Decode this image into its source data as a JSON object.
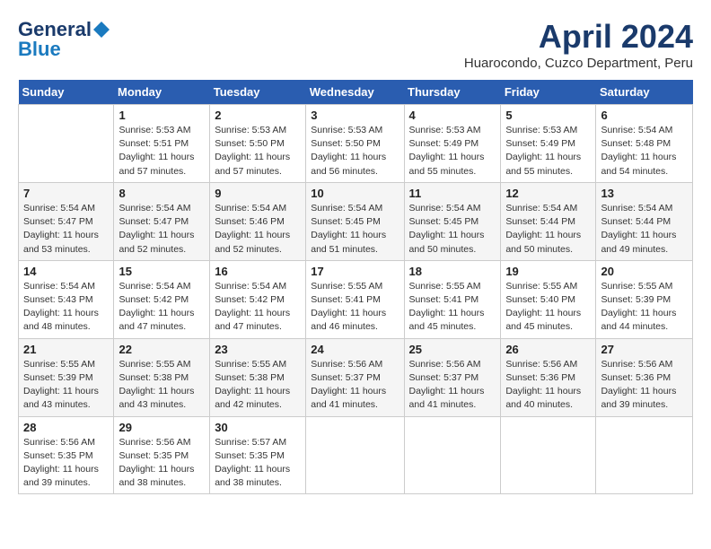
{
  "header": {
    "logo_general": "General",
    "logo_blue": "Blue",
    "title": "April 2024",
    "location": "Huarocondo, Cuzco Department, Peru"
  },
  "columns": [
    "Sunday",
    "Monday",
    "Tuesday",
    "Wednesday",
    "Thursday",
    "Friday",
    "Saturday"
  ],
  "weeks": [
    [
      {
        "day": "",
        "info": ""
      },
      {
        "day": "1",
        "info": "Sunrise: 5:53 AM\nSunset: 5:51 PM\nDaylight: 11 hours\nand 57 minutes."
      },
      {
        "day": "2",
        "info": "Sunrise: 5:53 AM\nSunset: 5:50 PM\nDaylight: 11 hours\nand 57 minutes."
      },
      {
        "day": "3",
        "info": "Sunrise: 5:53 AM\nSunset: 5:50 PM\nDaylight: 11 hours\nand 56 minutes."
      },
      {
        "day": "4",
        "info": "Sunrise: 5:53 AM\nSunset: 5:49 PM\nDaylight: 11 hours\nand 55 minutes."
      },
      {
        "day": "5",
        "info": "Sunrise: 5:53 AM\nSunset: 5:49 PM\nDaylight: 11 hours\nand 55 minutes."
      },
      {
        "day": "6",
        "info": "Sunrise: 5:54 AM\nSunset: 5:48 PM\nDaylight: 11 hours\nand 54 minutes."
      }
    ],
    [
      {
        "day": "7",
        "info": "Sunrise: 5:54 AM\nSunset: 5:47 PM\nDaylight: 11 hours\nand 53 minutes."
      },
      {
        "day": "8",
        "info": "Sunrise: 5:54 AM\nSunset: 5:47 PM\nDaylight: 11 hours\nand 52 minutes."
      },
      {
        "day": "9",
        "info": "Sunrise: 5:54 AM\nSunset: 5:46 PM\nDaylight: 11 hours\nand 52 minutes."
      },
      {
        "day": "10",
        "info": "Sunrise: 5:54 AM\nSunset: 5:45 PM\nDaylight: 11 hours\nand 51 minutes."
      },
      {
        "day": "11",
        "info": "Sunrise: 5:54 AM\nSunset: 5:45 PM\nDaylight: 11 hours\nand 50 minutes."
      },
      {
        "day": "12",
        "info": "Sunrise: 5:54 AM\nSunset: 5:44 PM\nDaylight: 11 hours\nand 50 minutes."
      },
      {
        "day": "13",
        "info": "Sunrise: 5:54 AM\nSunset: 5:44 PM\nDaylight: 11 hours\nand 49 minutes."
      }
    ],
    [
      {
        "day": "14",
        "info": "Sunrise: 5:54 AM\nSunset: 5:43 PM\nDaylight: 11 hours\nand 48 minutes."
      },
      {
        "day": "15",
        "info": "Sunrise: 5:54 AM\nSunset: 5:42 PM\nDaylight: 11 hours\nand 47 minutes."
      },
      {
        "day": "16",
        "info": "Sunrise: 5:54 AM\nSunset: 5:42 PM\nDaylight: 11 hours\nand 47 minutes."
      },
      {
        "day": "17",
        "info": "Sunrise: 5:55 AM\nSunset: 5:41 PM\nDaylight: 11 hours\nand 46 minutes."
      },
      {
        "day": "18",
        "info": "Sunrise: 5:55 AM\nSunset: 5:41 PM\nDaylight: 11 hours\nand 45 minutes."
      },
      {
        "day": "19",
        "info": "Sunrise: 5:55 AM\nSunset: 5:40 PM\nDaylight: 11 hours\nand 45 minutes."
      },
      {
        "day": "20",
        "info": "Sunrise: 5:55 AM\nSunset: 5:39 PM\nDaylight: 11 hours\nand 44 minutes."
      }
    ],
    [
      {
        "day": "21",
        "info": "Sunrise: 5:55 AM\nSunset: 5:39 PM\nDaylight: 11 hours\nand 43 minutes."
      },
      {
        "day": "22",
        "info": "Sunrise: 5:55 AM\nSunset: 5:38 PM\nDaylight: 11 hours\nand 43 minutes."
      },
      {
        "day": "23",
        "info": "Sunrise: 5:55 AM\nSunset: 5:38 PM\nDaylight: 11 hours\nand 42 minutes."
      },
      {
        "day": "24",
        "info": "Sunrise: 5:56 AM\nSunset: 5:37 PM\nDaylight: 11 hours\nand 41 minutes."
      },
      {
        "day": "25",
        "info": "Sunrise: 5:56 AM\nSunset: 5:37 PM\nDaylight: 11 hours\nand 41 minutes."
      },
      {
        "day": "26",
        "info": "Sunrise: 5:56 AM\nSunset: 5:36 PM\nDaylight: 11 hours\nand 40 minutes."
      },
      {
        "day": "27",
        "info": "Sunrise: 5:56 AM\nSunset: 5:36 PM\nDaylight: 11 hours\nand 39 minutes."
      }
    ],
    [
      {
        "day": "28",
        "info": "Sunrise: 5:56 AM\nSunset: 5:35 PM\nDaylight: 11 hours\nand 39 minutes."
      },
      {
        "day": "29",
        "info": "Sunrise: 5:56 AM\nSunset: 5:35 PM\nDaylight: 11 hours\nand 38 minutes."
      },
      {
        "day": "30",
        "info": "Sunrise: 5:57 AM\nSunset: 5:35 PM\nDaylight: 11 hours\nand 38 minutes."
      },
      {
        "day": "",
        "info": ""
      },
      {
        "day": "",
        "info": ""
      },
      {
        "day": "",
        "info": ""
      },
      {
        "day": "",
        "info": ""
      }
    ]
  ]
}
